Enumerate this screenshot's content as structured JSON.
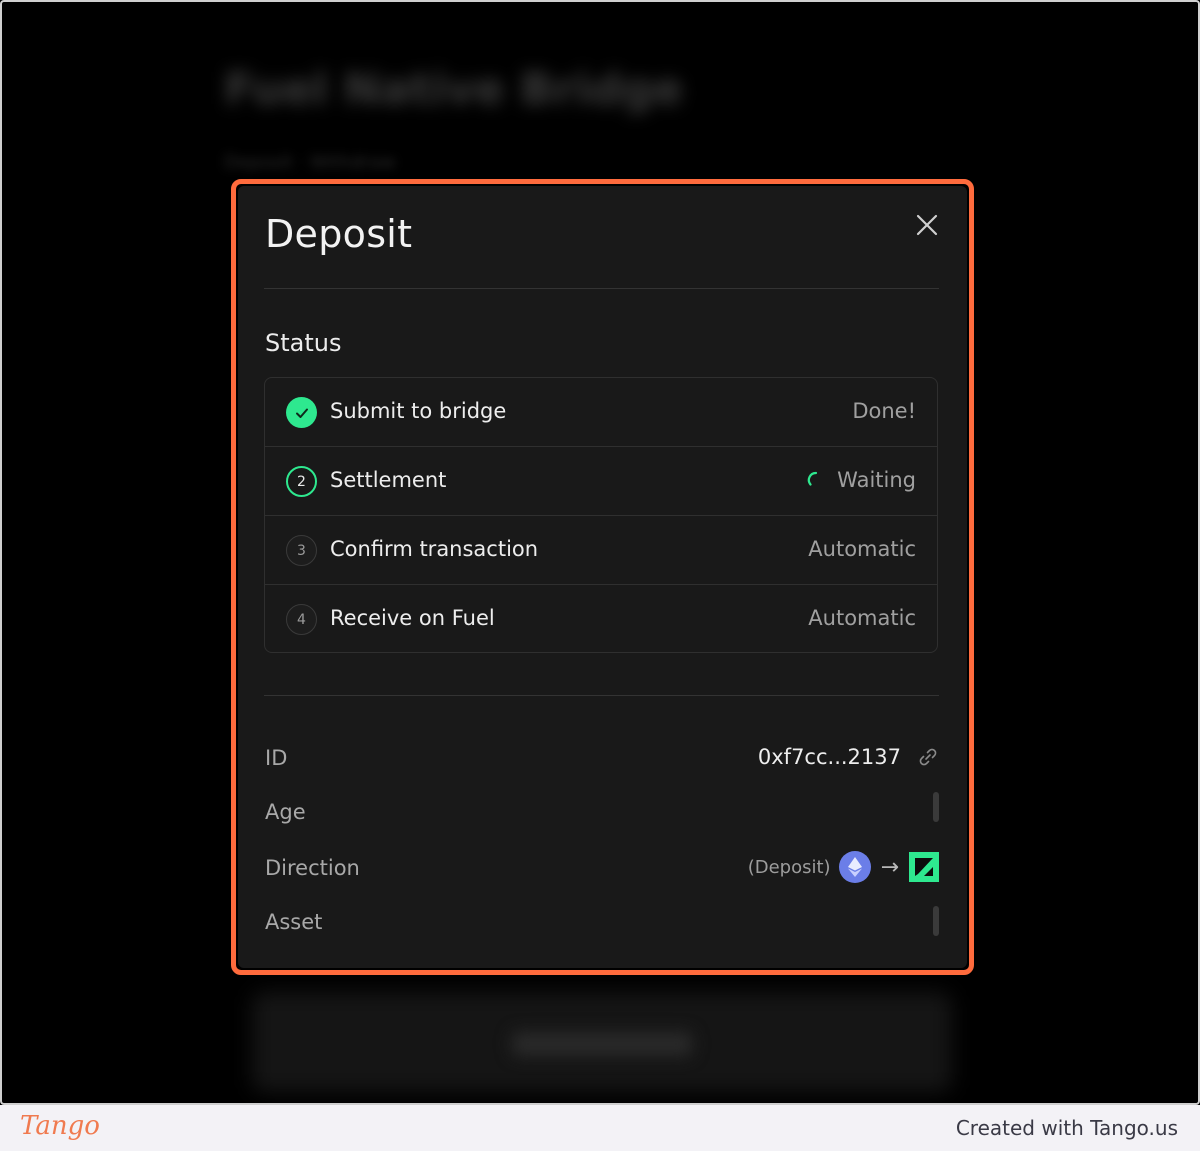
{
  "background": {
    "title": "Fuel Native Bridge",
    "subtitle": "Deposit  ·  Withdraw"
  },
  "modal": {
    "title": "Deposit",
    "status_title": "Status",
    "steps": [
      {
        "number": "1",
        "label": "Submit to bridge",
        "status": "Done!",
        "state": "done"
      },
      {
        "number": "2",
        "label": "Settlement",
        "status": "Waiting",
        "state": "active"
      },
      {
        "number": "3",
        "label": "Confirm transaction",
        "status": "Automatic",
        "state": "pending"
      },
      {
        "number": "4",
        "label": "Receive on Fuel",
        "status": "Automatic",
        "state": "pending"
      }
    ],
    "info": {
      "id_label": "ID",
      "id_value": "0xf7cc...2137",
      "age_label": "Age",
      "direction_label": "Direction",
      "direction_value": "(Deposit)",
      "asset_label": "Asset"
    }
  },
  "icons": {
    "close": "close-icon",
    "check": "check-icon",
    "spinner": "spinner-icon",
    "link": "link-icon",
    "eth": "ethereum-icon",
    "arrow": "arrow-right-icon",
    "fuel": "fuel-icon"
  },
  "colors": {
    "accent": "#2ee88f",
    "highlight": "#ff6b3d",
    "eth": "#6b7ee8"
  },
  "footer": {
    "logo": "Tango",
    "credit": "Created with Tango.us"
  }
}
